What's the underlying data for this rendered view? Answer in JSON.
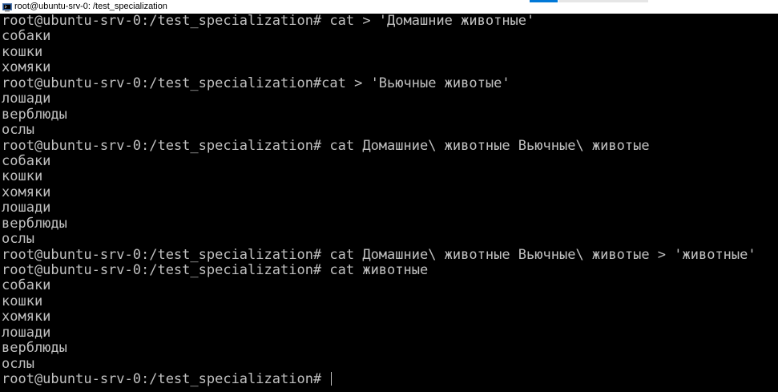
{
  "window": {
    "title": "root@ubuntu-srv-0: /test_specialization",
    "icon": "putty-terminal-icon",
    "accent_color": "#0078d7"
  },
  "terminal": {
    "background": "#000000",
    "foreground": "#c0c0c0",
    "lines": [
      "root@ubuntu-srv-0:/test_specialization# cat > 'Домашние животные'",
      "собаки",
      "кошки",
      "хомяки",
      "root@ubuntu-srv-0:/test_specialization#cat > 'Вьючные животые'",
      "лошади",
      "верблюды",
      "ослы",
      "root@ubuntu-srv-0:/test_specialization# cat Домашние\\ животные Вьючные\\ животые",
      "собаки",
      "кошки",
      "хомяки",
      "лошади",
      "верблюды",
      "ослы",
      "root@ubuntu-srv-0:/test_specialization# cat Домашние\\ животные Вьючные\\ животые > 'животные'",
      "root@ubuntu-srv-0:/test_specialization# cat животные",
      "собаки",
      "кошки",
      "хомяки",
      "лошади",
      "верблюды",
      "ослы"
    ],
    "current_prompt": "root@ubuntu-srv-0:/test_specialization# "
  }
}
